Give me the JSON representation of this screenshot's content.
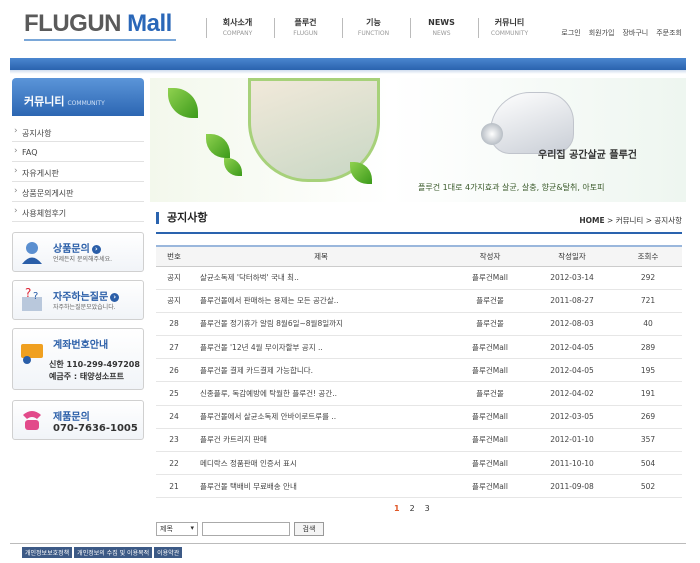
{
  "header": {
    "logo_a": "FLUGUN",
    "logo_b": " Mall",
    "nav": [
      {
        "kr": "회사소개",
        "en": "COMPANY"
      },
      {
        "kr": "플루건",
        "en": "FLUGUN"
      },
      {
        "kr": "기능",
        "en": "FUNCTION"
      },
      {
        "kr": "NEWS",
        "en": "NEWS"
      },
      {
        "kr": "커뮤니티",
        "en": "COMMUNITY"
      }
    ],
    "util": [
      "로그인",
      "회원가입",
      "장바구니",
      "주문조회"
    ]
  },
  "sidebar": {
    "title_kr": "커뮤니티",
    "title_en": "COMMUNITY",
    "items": [
      "공지사항",
      "FAQ",
      "자유게시판",
      "상품문의게시판",
      "사용체험후기"
    ]
  },
  "boxes": {
    "product_q": {
      "title": "상품문의",
      "desc": "언제든지 문의해주세요."
    },
    "faq": {
      "title": "자주하는질문",
      "desc": "자주하는질문모았습니다."
    },
    "account": {
      "title": "계좌번호안내",
      "line1": "신한 110-299-497208",
      "line2": "예금주 : 태양성소프트"
    },
    "contact": {
      "title": "제품문의",
      "phone": "070-7636-1005"
    }
  },
  "banner": {
    "slogan": "우리집 공간살균 플루건",
    "desc": "플루건 1대로 4가지효과 살균, 살충, 향균&탈취, 아토피"
  },
  "content": {
    "title": "공지사항",
    "crumb": [
      "HOME",
      "커뮤니티",
      "공지사항"
    ],
    "headers": [
      "번호",
      "제목",
      "작성자",
      "작성일자",
      "조회수"
    ],
    "rows": [
      [
        "공지",
        "살균소독제 '닥터하벅' 국내 최..",
        "플루건Mall",
        "2012-03-14",
        "292"
      ],
      [
        "공지",
        "플루건몰에서 판매하는 용제는 모든 공간살..",
        "플루건몰",
        "2011-08-27",
        "721"
      ],
      [
        "28",
        "플루건몰 정기휴가 알림 8월6일~8월8일까지",
        "플루건몰",
        "2012-08-03",
        "40"
      ],
      [
        "27",
        "플루건몰 '12년 4월 무이자할부 공지 ..",
        "플루건Mall",
        "2012-04-05",
        "289"
      ],
      [
        "26",
        "플루건몰 결제 카드결제 가능합니다.",
        "플루건Mall",
        "2012-04-05",
        "195"
      ],
      [
        "25",
        "신종플루, 독감예방에 탁월한 플루건! 공간..",
        "플루건몰",
        "2012-04-02",
        "191"
      ],
      [
        "24",
        "플루건몰에서 살균소독제 안바이로트루를 ..",
        "플루건Mall",
        "2012-03-05",
        "269"
      ],
      [
        "23",
        "플루건 카트리지 판매",
        "플루건Mall",
        "2012-01-10",
        "357"
      ],
      [
        "22",
        "메디락스 정품판매 인증서 표시",
        "플루건Mall",
        "2011-10-10",
        "504"
      ],
      [
        "21",
        "플루건몰 택배비 무료배송 안내",
        "플루건Mall",
        "2011-09-08",
        "502"
      ]
    ],
    "pages": [
      "1",
      "2",
      "3"
    ]
  },
  "search": {
    "select": "제목",
    "placeholder": "",
    "button": "검색"
  },
  "footer": [
    "개인정보보호정책",
    "개인정보의 수집 및 이용목적",
    "이용약관"
  ],
  "colors": {
    "primary": "#2a63ae",
    "accent": "#e0592a"
  }
}
